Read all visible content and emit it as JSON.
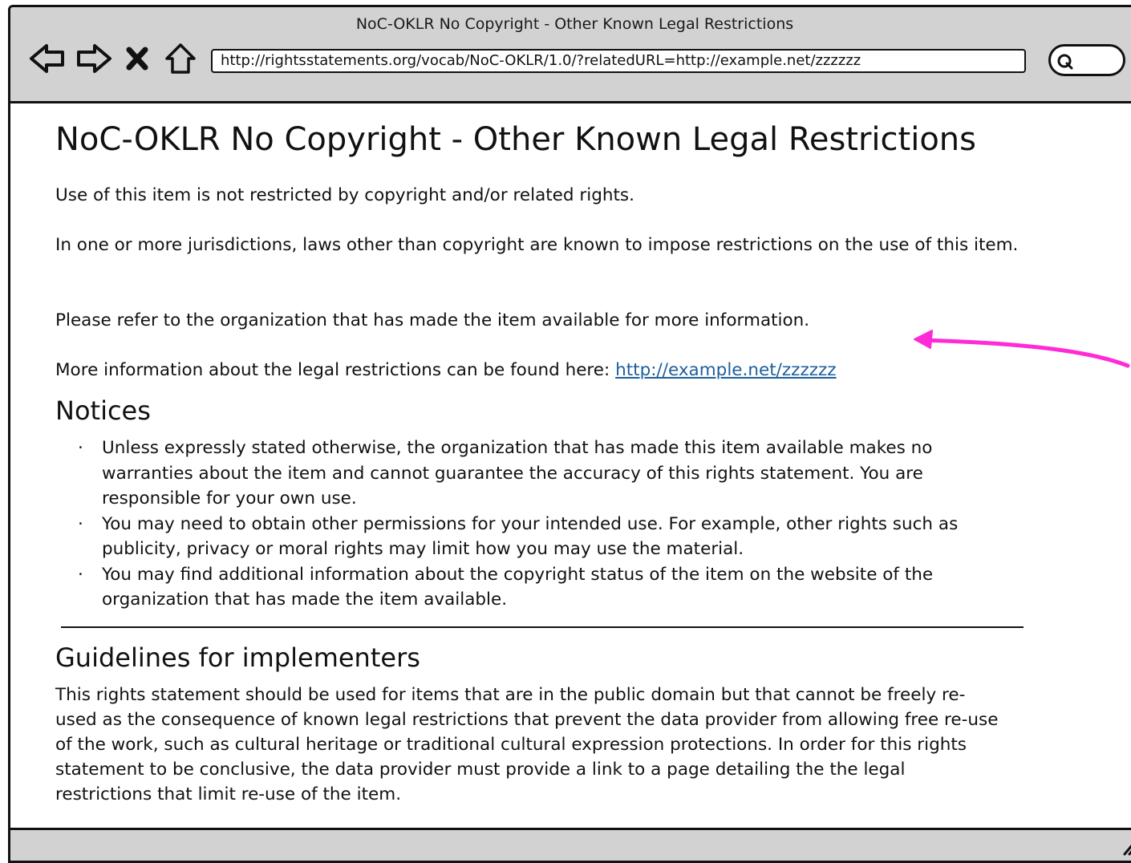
{
  "window": {
    "title": "NoC-OKLR No Copyright - Other Known Legal Restrictions"
  },
  "toolbar": {
    "back_icon": "back-arrow-icon",
    "forward_icon": "forward-arrow-icon",
    "stop_icon": "stop-x-icon",
    "home_icon": "home-icon",
    "url": "http://rightsstatements.org/vocab/NoC-OKLR/1.0/?relatedURL=http://example.net/zzzzzz",
    "search_icon": "search-icon"
  },
  "page": {
    "title": "NoC-OKLR No Copyright - Other Known Legal Restrictions",
    "intro": "Use of this item is not restricted by copyright and/or related rights.",
    "jurisdictions": "In one or more jurisdictions, laws other than copyright are known to impose restrictions on the use of this item.",
    "refer": "Please refer to the organization that has made the item available for more information.",
    "more_info_prefix": "More information about the legal restrictions can be found here: ",
    "more_info_link": "http://example.net/zzzzzz",
    "notices_heading": "Notices",
    "notices": [
      "Unless expressly stated otherwise, the organization that has made this item available makes no warranties about the item and cannot guarantee the accuracy of this rights statement. You are responsible for your own use.",
      "You may need to obtain other permissions for your intended use. For example, other rights such as publicity, privacy or moral rights may limit how you may use the material.",
      "You may find additional information about the copyright status of the item on the website of the organization that has made the item available."
    ],
    "guidelines_heading": "Guidelines for implementers",
    "guidelines": "This rights statement should be used for items that are in the public domain but that cannot be freely re-used as the consequence of known legal restrictions that prevent the data provider from allowing free re-use of the work, such as cultural heritage or traditional cultural expression protections. In order for this rights statement to be conclusive, the data provider must provide a link to a page detailing the the legal restrictions that limit re-use of the item."
  },
  "colors": {
    "chrome": "#d2d2d2",
    "link": "#1e5f9c",
    "annotation": "#ff2bd6"
  }
}
